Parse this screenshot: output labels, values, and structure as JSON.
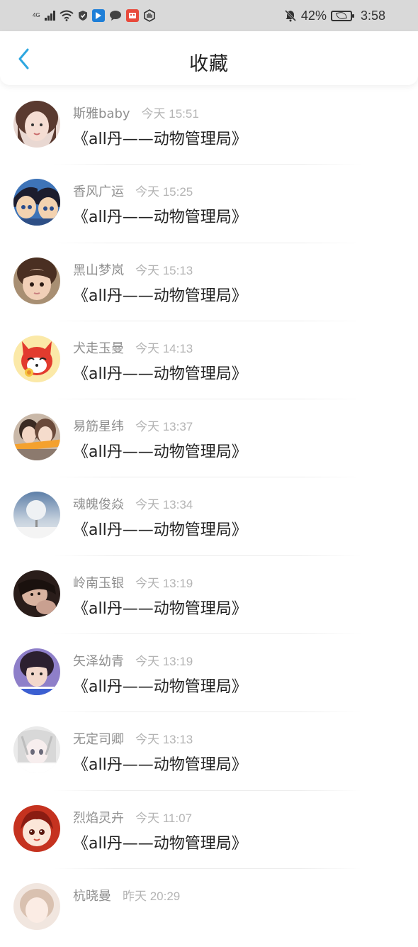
{
  "status_bar": {
    "network": "4G",
    "battery_percent": "42%",
    "time": "3:58",
    "icons": [
      "signal-icon",
      "wifi-icon",
      "shield-icon",
      "app-icon",
      "chat-icon",
      "app-icon",
      "hand-icon",
      "mute-icon",
      "battery-icon"
    ]
  },
  "header": {
    "title": "收藏"
  },
  "colors": {
    "accent": "#2ea7e0",
    "name": "#8f8f8f",
    "time": "#b4b4b4"
  },
  "items": [
    {
      "name": "斯雅baby",
      "time": "今天 15:51",
      "content": "《all丹——动物管理局》"
    },
    {
      "name": "香风广运",
      "time": "今天 15:25",
      "content": "《all丹——动物管理局》"
    },
    {
      "name": "黑山梦岚",
      "time": "今天 15:13",
      "content": "《all丹——动物管理局》"
    },
    {
      "name": "犬走玉曼",
      "time": "今天 14:13",
      "content": "《all丹——动物管理局》"
    },
    {
      "name": "易筋星纬",
      "time": "今天 13:37",
      "content": "《all丹——动物管理局》"
    },
    {
      "name": "魂魄俊焱",
      "time": "今天 13:34",
      "content": "《all丹——动物管理局》"
    },
    {
      "name": "岭南玉银",
      "time": "今天 13:19",
      "content": "《all丹——动物管理局》"
    },
    {
      "name": "矢泽幼青",
      "time": "今天 13:19",
      "content": "《all丹——动物管理局》"
    },
    {
      "name": "无定司卿",
      "time": "今天 13:13",
      "content": "《all丹——动物管理局》"
    },
    {
      "name": "烈焰灵卉",
      "time": "今天 11:07",
      "content": "《all丹——动物管理局》"
    },
    {
      "name": "杭晓曼",
      "time": "昨天 20:29",
      "content": ""
    }
  ]
}
